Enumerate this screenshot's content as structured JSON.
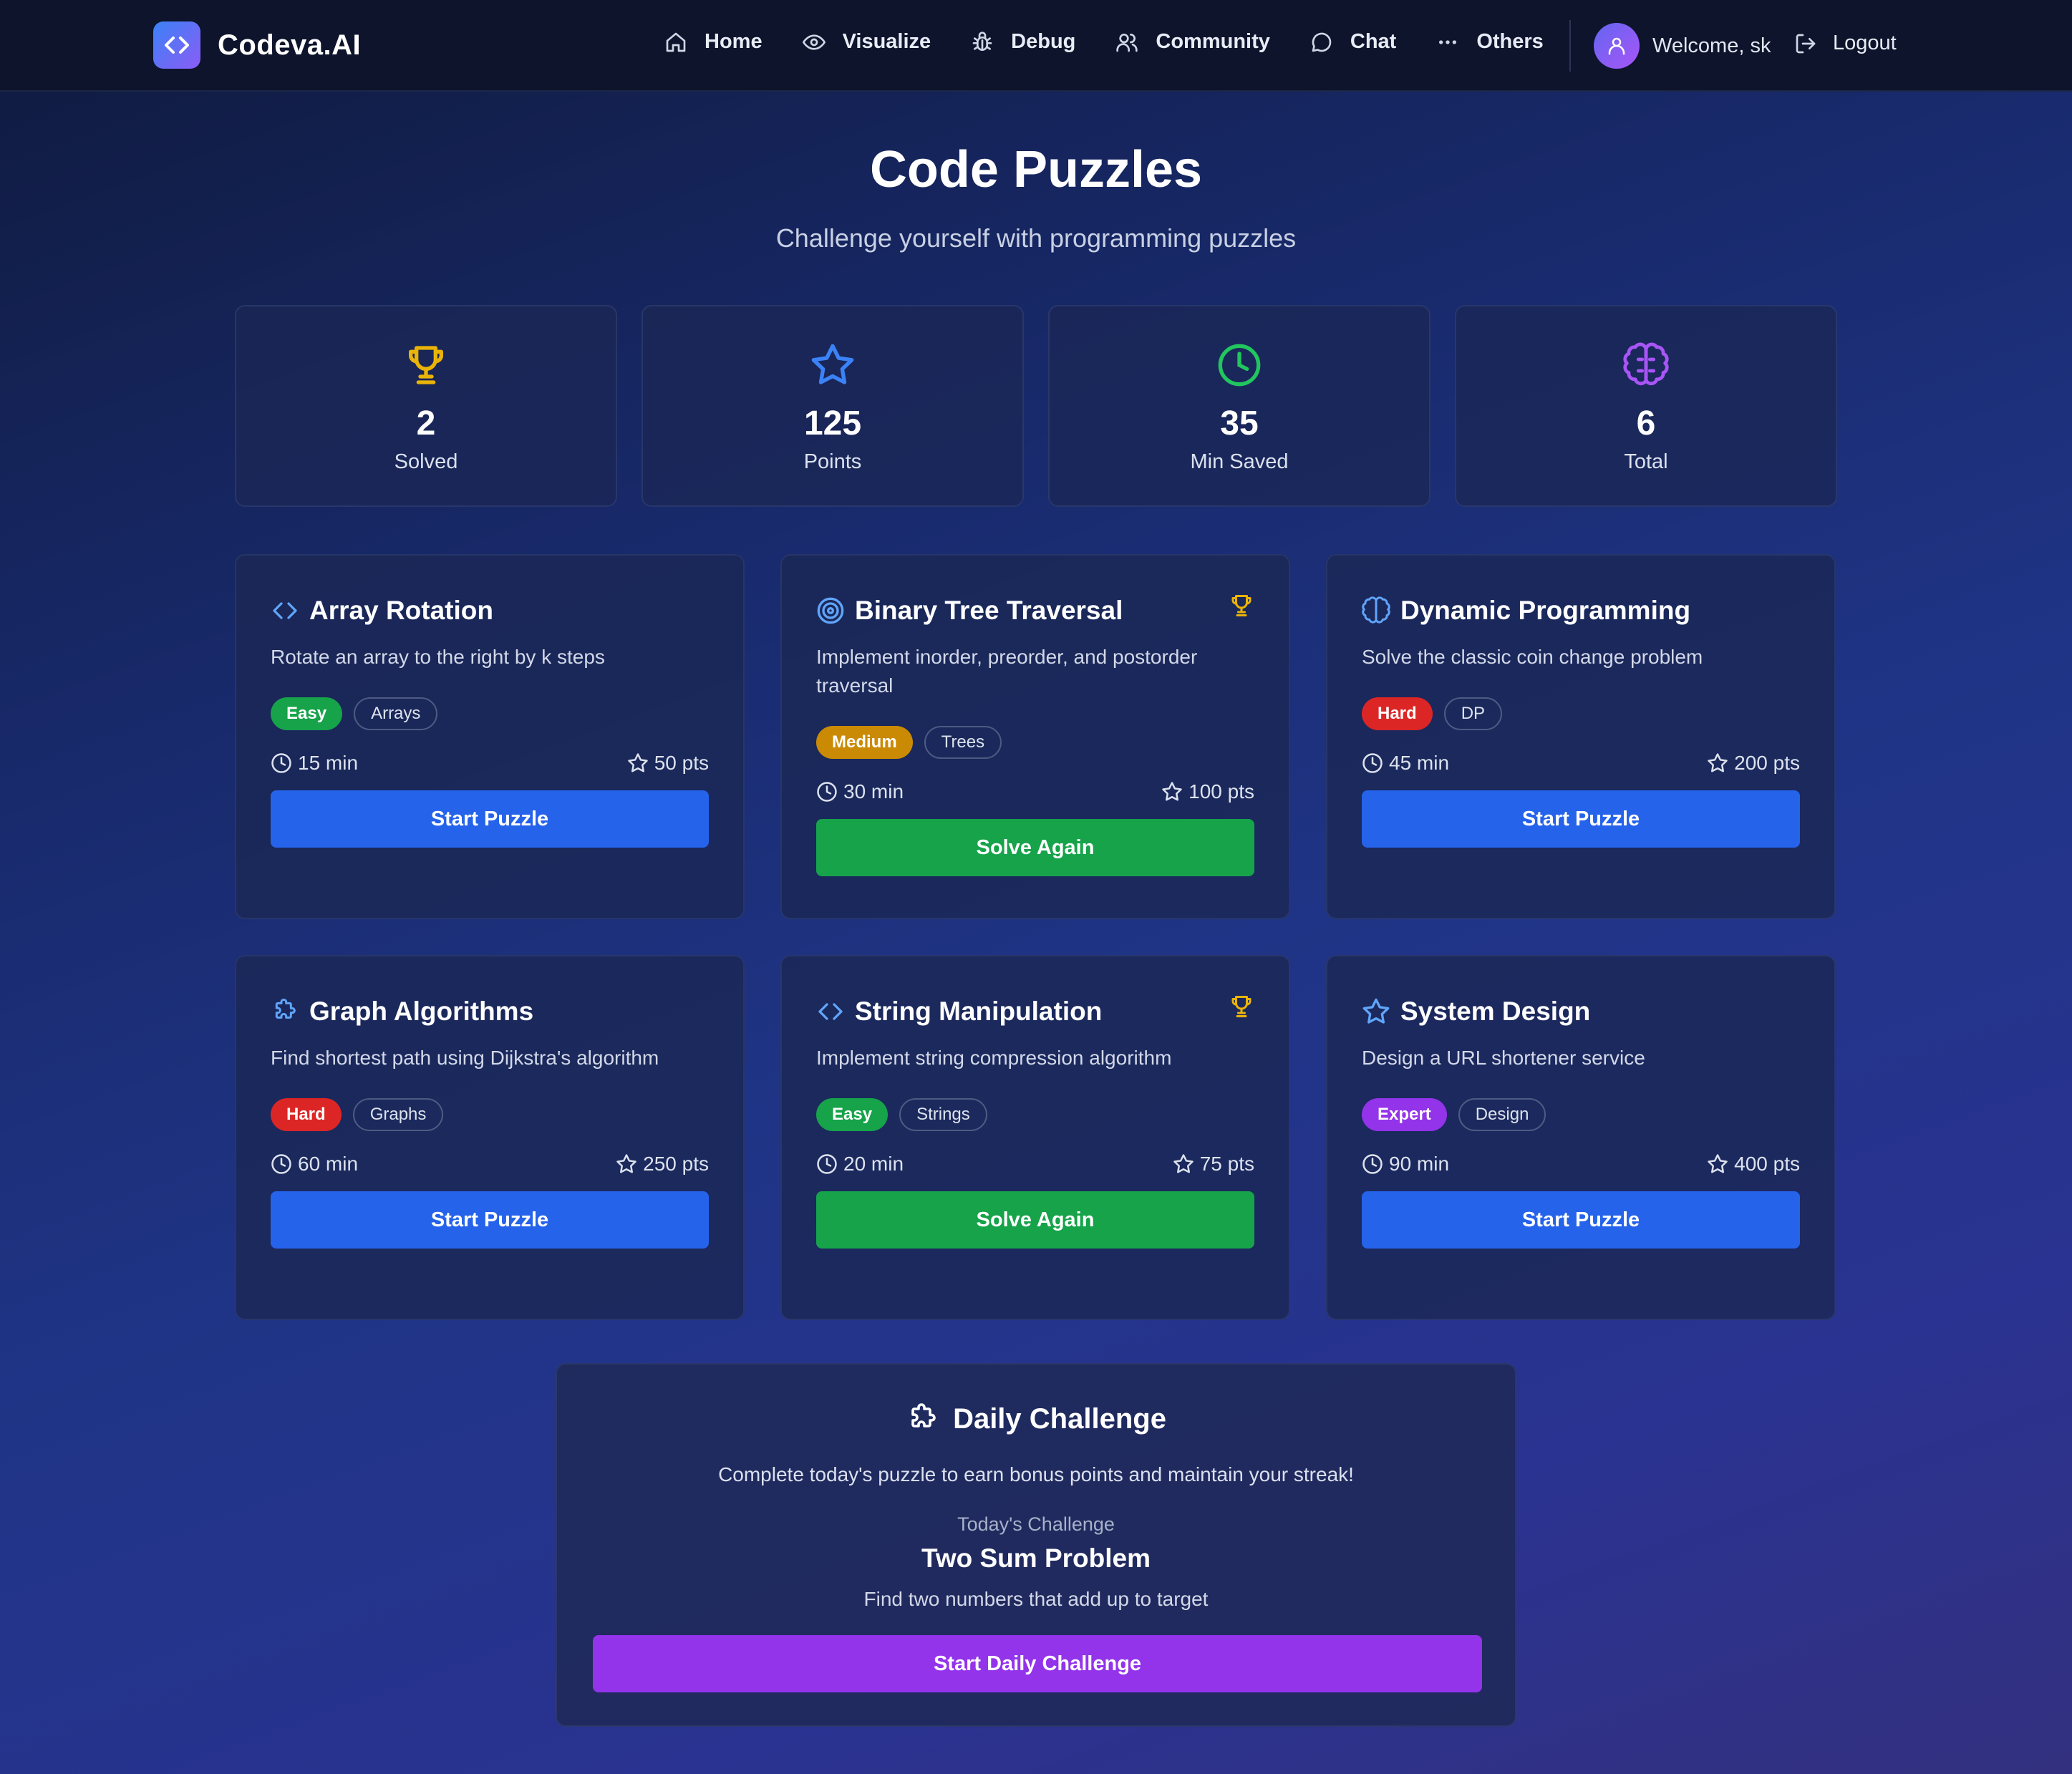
{
  "brand": {
    "name": "Codeva.AI",
    "logo_icon": "code-icon"
  },
  "nav": {
    "items": [
      {
        "label": "Home",
        "icon": "home-icon"
      },
      {
        "label": "Visualize",
        "icon": "eye-icon"
      },
      {
        "label": "Debug",
        "icon": "bug-icon"
      },
      {
        "label": "Community",
        "icon": "users-icon"
      },
      {
        "label": "Chat",
        "icon": "chat-icon"
      },
      {
        "label": "Others",
        "icon": "more-icon"
      }
    ],
    "welcome": "Welcome, sk",
    "logout": "Logout"
  },
  "header": {
    "title": "Code Puzzles",
    "subtitle": "Challenge yourself with programming puzzles"
  },
  "stats": [
    {
      "value": "2",
      "label": "Solved",
      "icon": "trophy-icon",
      "color": "#eab308"
    },
    {
      "value": "125",
      "label": "Points",
      "icon": "star-icon",
      "color": "#3b82f6"
    },
    {
      "value": "35",
      "label": "Min Saved",
      "icon": "clock-icon",
      "color": "#22c55e"
    },
    {
      "value": "6",
      "label": "Total",
      "icon": "brain-icon",
      "color": "#a855f7"
    }
  ],
  "puzzles": [
    {
      "title": "Array Rotation",
      "icon": "code-icon",
      "desc": "Rotate an array to the right by k steps",
      "difficulty": "Easy",
      "difficulty_color": "#16a34a",
      "topic": "Arrays",
      "time": "15 min",
      "points": "50 pts",
      "button": "Start Puzzle",
      "solved": false
    },
    {
      "title": "Binary Tree Traversal",
      "icon": "target-icon",
      "desc": "Implement inorder, preorder, and postorder traversal",
      "difficulty": "Medium",
      "difficulty_color": "#ca8a04",
      "topic": "Trees",
      "time": "30 min",
      "points": "100 pts",
      "button": "Solve Again",
      "solved": true
    },
    {
      "title": "Dynamic Programming",
      "icon": "brain-icon",
      "desc": "Solve the classic coin change problem",
      "difficulty": "Hard",
      "difficulty_color": "#dc2626",
      "topic": "DP",
      "time": "45 min",
      "points": "200 pts",
      "button": "Start Puzzle",
      "solved": false
    },
    {
      "title": "Graph Algorithms",
      "icon": "puzzle-icon",
      "desc": "Find shortest path using Dijkstra's algorithm",
      "difficulty": "Hard",
      "difficulty_color": "#dc2626",
      "topic": "Graphs",
      "time": "60 min",
      "points": "250 pts",
      "button": "Start Puzzle",
      "solved": false
    },
    {
      "title": "String Manipulation",
      "icon": "code-icon",
      "desc": "Implement string compression algorithm",
      "difficulty": "Easy",
      "difficulty_color": "#16a34a",
      "topic": "Strings",
      "time": "20 min",
      "points": "75 pts",
      "button": "Solve Again",
      "solved": true
    },
    {
      "title": "System Design",
      "icon": "star-icon",
      "desc": "Design a URL shortener service",
      "difficulty": "Expert",
      "difficulty_color": "#9333ea",
      "topic": "Design",
      "time": "90 min",
      "points": "400 pts",
      "button": "Start Puzzle",
      "solved": false
    }
  ],
  "daily": {
    "title": "Daily Challenge",
    "desc": "Complete today's puzzle to earn bonus points and maintain your streak!",
    "today_label": "Today's Challenge",
    "today_name": "Two Sum Problem",
    "today_desc": "Find two numbers that add up to target",
    "button": "Start Daily Challenge"
  },
  "colors": {
    "accent_blue": "#2563eb",
    "accent_green": "#16a34a",
    "accent_purple": "#9333ea"
  }
}
